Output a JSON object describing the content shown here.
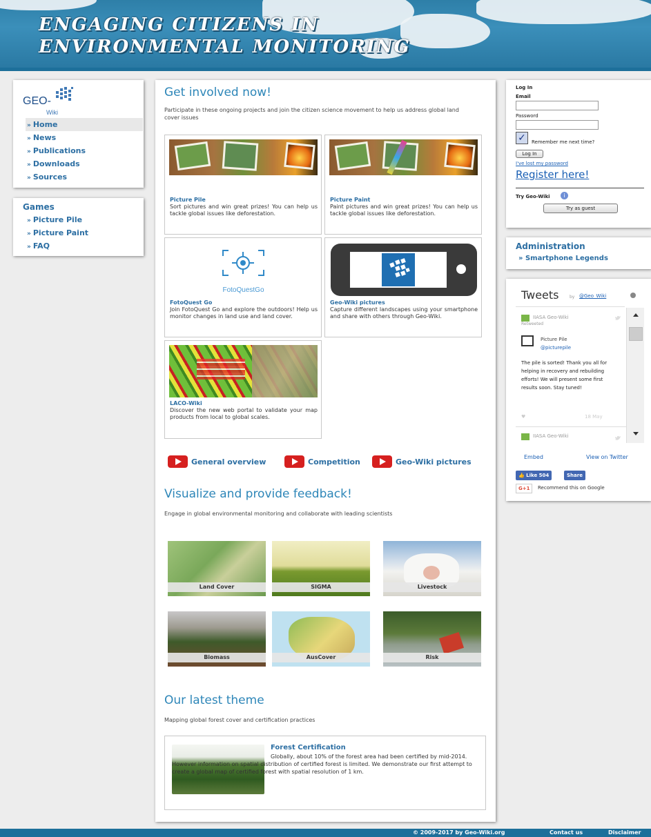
{
  "banner": {
    "title_line1": "Engaging Citizens in",
    "title_line2": "Environmental Monitoring"
  },
  "logo": {
    "geo": "GEO-",
    "wiki": "Wiki"
  },
  "nav": {
    "items": [
      {
        "label": "Home"
      },
      {
        "label": "News"
      },
      {
        "label": "Publications"
      },
      {
        "label": "Downloads"
      },
      {
        "label": "Sources"
      }
    ]
  },
  "games": {
    "heading": "Games",
    "items": [
      {
        "label": "Picture Pile"
      },
      {
        "label": "Picture Paint"
      },
      {
        "label": "FAQ"
      }
    ]
  },
  "main": {
    "get_involved": {
      "title": "Get involved now!",
      "intro": "Participate in these ongoing projects and join the citizen science movement to help us address global land cover issues",
      "cards": [
        {
          "title": "Picture Pile",
          "desc": "Sort pictures and win great prizes! You can help us tackle global issues like deforestation."
        },
        {
          "title": "Picture Paint",
          "desc": "Paint pictures and win great prizes! You can help us tackle global issues like deforestation."
        },
        {
          "title": "FotoQuest Go",
          "desc": "Join FotoQuest Go and explore the outdoors! Help us monitor changes in land use and land cover.",
          "logo_text": "FotoQuestGo"
        },
        {
          "title": "Geo-Wiki pictures",
          "desc": "Capture different landscapes using your smartphone and share with others through Geo-Wiki."
        },
        {
          "title": "LACO-Wiki",
          "desc": "Discover the new web portal to validate your map products from local to global scales."
        }
      ]
    },
    "videos": [
      {
        "label": "General overview"
      },
      {
        "label": "Competition"
      },
      {
        "label": "Geo-Wiki pictures"
      }
    ],
    "visualize": {
      "title": "Visualize and provide feedback!",
      "intro": "Engage in global environmental monitoring and collaborate with leading scientists",
      "tiles": [
        {
          "label": "Land Cover"
        },
        {
          "label": "SIGMA"
        },
        {
          "label": "Livestock"
        },
        {
          "label": "Biomass"
        },
        {
          "label": "AusCover"
        },
        {
          "label": "Risk"
        }
      ]
    },
    "theme": {
      "title": "Our latest theme",
      "intro": "Mapping global forest cover and certification practices",
      "card_title": "Forest Certification",
      "card_desc": "Globally, about 10% of the forest area had been certified by mid-2014. However information on spatial distribution of certified forest is limited. We demonstrate our first attempt to create a global map of certified forest with spatial resolution of 1 km."
    }
  },
  "login": {
    "heading": "Log In",
    "email_label": "Email",
    "password_label": "Password",
    "remember_label": "Remember me next time?",
    "login_button": "Log In",
    "lost_password": "I've lost my password",
    "register": "Register here!",
    "try_label": "Try Geo-Wiki",
    "guest_button": "Try as guest"
  },
  "admin": {
    "heading": "Administration",
    "item": "Smartphone Legends"
  },
  "tweets": {
    "title": "Tweets",
    "by": "by",
    "handle": "@Geo_Wiki",
    "tweet1_author": "IIASA Geo-Wiki",
    "tweet1_retweeted": "Retweeted",
    "tweet1_inner_name": "Picture Pile",
    "tweet1_inner_handle": "@picturepile",
    "tweet1_text": "The pile is sorted! Thank you all for helping in recovery and rebuilding efforts! We will present some first results soon. Stay tuned!",
    "tweet1_date": "18 May",
    "tweet2_author": "IIASA Geo-Wiki",
    "embed": "Embed",
    "view_on_twitter": "View on Twitter",
    "like_label": "Like 504",
    "share_label": "Share",
    "gplus_label": "G+1",
    "recommend": "Recommend this on Google"
  },
  "footer": {
    "copyright": "© 2009-2017 by Geo-Wiki.org",
    "contact": "Contact us",
    "disclaimer": "Disclaimer"
  },
  "colors": {
    "accent": "#2d86b8",
    "link": "#2d6fa3",
    "banner": "#2e7fa8",
    "youtube": "#d6201f"
  }
}
